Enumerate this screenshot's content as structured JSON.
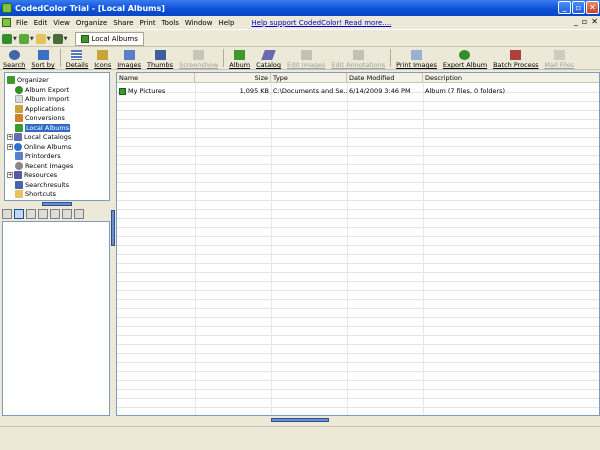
{
  "window": {
    "title": "CodedColor Trial - [Local Albums]"
  },
  "title_buttons": [
    "_",
    "▫",
    "✕"
  ],
  "menu": {
    "items": [
      "File",
      "Edit",
      "View",
      "Organize",
      "Share",
      "Print",
      "Tools",
      "Window",
      "Help"
    ],
    "help_link": "Help support CodedColor! Read more....",
    "mdi_controls": [
      "_",
      "▫",
      "✕"
    ]
  },
  "nav": {
    "tab_label": "Local Albums"
  },
  "toolbar": {
    "search": "Search",
    "sort_by": "Sort by",
    "details": "Details",
    "icons": "Icons",
    "images": "Images",
    "thumbs": "Thumbs",
    "screenshow": "Screenshow",
    "album": "Album",
    "catalog": "Catalog",
    "edit_images": "Edit Images",
    "edit_annotations": "Edit Annotations",
    "print_images": "Print Images",
    "export_album": "Export Album",
    "batch_process": "Batch Process",
    "mail_files": "Mail Files"
  },
  "tree": {
    "root": "Organizer",
    "items": [
      "Album Export",
      "Album Import",
      "Applications",
      "Conversions",
      "Local Albums",
      "Local Catalogs",
      "Online Albums",
      "Printorders",
      "Recent Images",
      "Resources",
      "Searchresults",
      "Shortcuts"
    ]
  },
  "list": {
    "columns": [
      "Name",
      "Size",
      "Type",
      "Date Modified",
      "Description"
    ],
    "rows": [
      {
        "name": "My Pictures",
        "size": "1,095 KB",
        "type": "C:\\Documents and Se...",
        "date": "6/14/2009 3:46 PM",
        "description": "Album (7 files, 0 folders)"
      }
    ]
  },
  "colors": {
    "accent": "#316ac5",
    "titlebar": "#0a4fd6",
    "chrome": "#ece9d8"
  }
}
